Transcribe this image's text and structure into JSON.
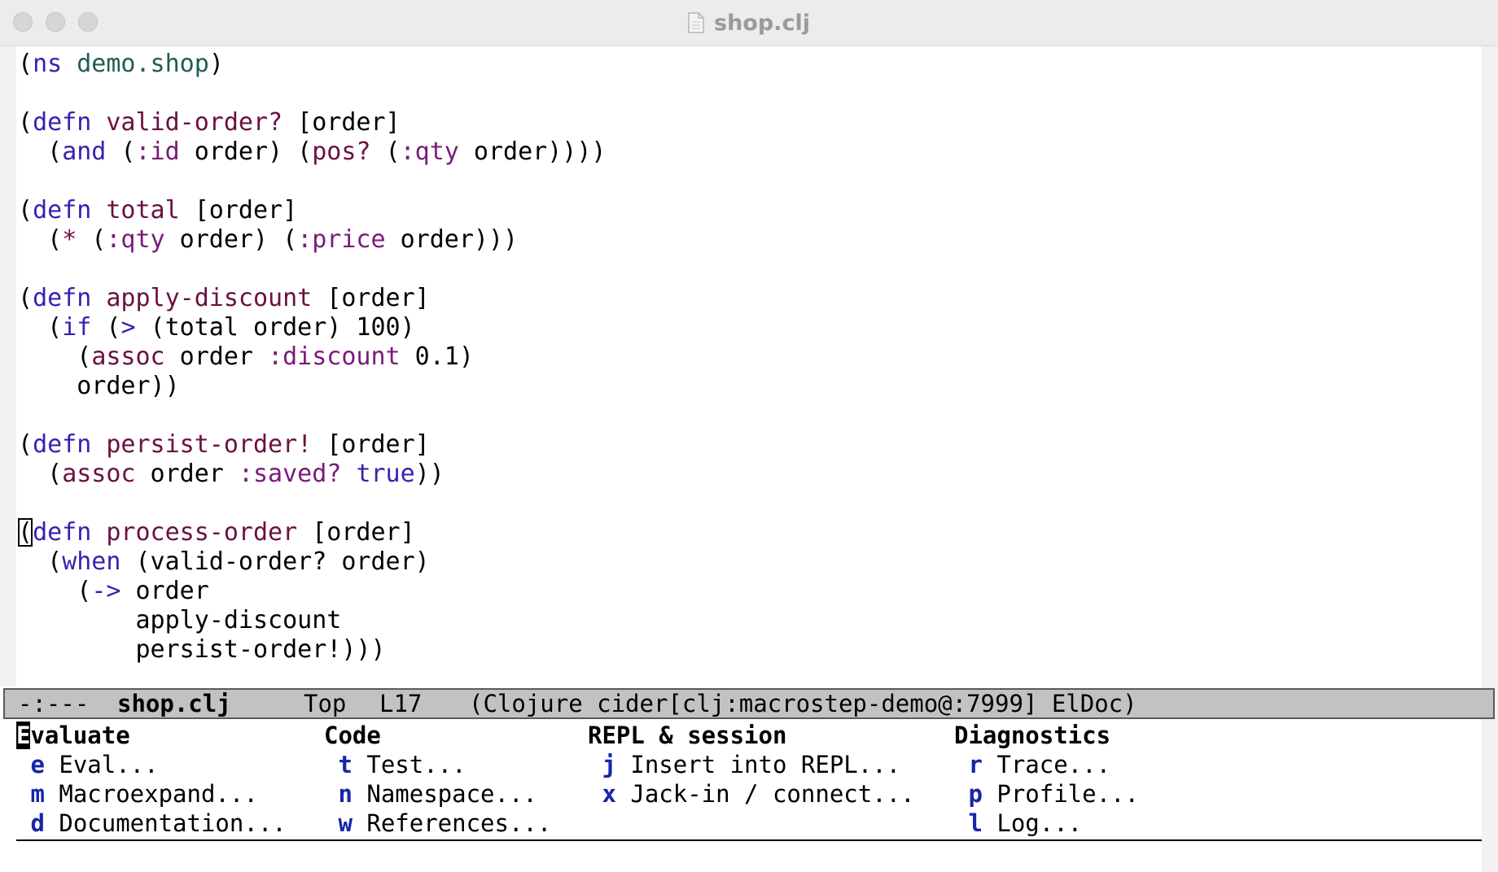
{
  "window": {
    "title": "shop.clj"
  },
  "code_lines": [
    [
      [
        "p",
        "("
      ],
      [
        "kw",
        "ns"
      ],
      [
        "p",
        " "
      ],
      [
        "ns",
        "demo.shop"
      ],
      [
        "p",
        ")"
      ]
    ],
    [],
    [
      [
        "p",
        "("
      ],
      [
        "kw",
        "defn"
      ],
      [
        "p",
        " "
      ],
      [
        "fn",
        "valid-order?"
      ],
      [
        "p",
        " [order]"
      ]
    ],
    [
      [
        "p",
        "  ("
      ],
      [
        "kw",
        "and"
      ],
      [
        "p",
        " ("
      ],
      [
        "key",
        ":id"
      ],
      [
        "p",
        " order) ("
      ],
      [
        "fn",
        "pos?"
      ],
      [
        "p",
        " ("
      ],
      [
        "key",
        ":qty"
      ],
      [
        "p",
        " order))))"
      ]
    ],
    [],
    [
      [
        "p",
        "("
      ],
      [
        "kw",
        "defn"
      ],
      [
        "p",
        " "
      ],
      [
        "fn",
        "total"
      ],
      [
        "p",
        " [order]"
      ]
    ],
    [
      [
        "p",
        "  ("
      ],
      [
        "fn",
        "*"
      ],
      [
        "p",
        " ("
      ],
      [
        "key",
        ":qty"
      ],
      [
        "p",
        " order) ("
      ],
      [
        "key",
        ":price"
      ],
      [
        "p",
        " order)))"
      ]
    ],
    [],
    [
      [
        "p",
        "("
      ],
      [
        "kw",
        "defn"
      ],
      [
        "p",
        " "
      ],
      [
        "fn",
        "apply-discount"
      ],
      [
        "p",
        " [order]"
      ]
    ],
    [
      [
        "p",
        "  ("
      ],
      [
        "kw",
        "if"
      ],
      [
        "p",
        " ("
      ],
      [
        "kw",
        ">"
      ],
      [
        "p",
        " (total order) 100)"
      ]
    ],
    [
      [
        "p",
        "    ("
      ],
      [
        "fn",
        "assoc"
      ],
      [
        "p",
        " order "
      ],
      [
        "key",
        ":discount"
      ],
      [
        "p",
        " 0.1)"
      ]
    ],
    [
      [
        "p",
        "    order))"
      ]
    ],
    [],
    [
      [
        "p",
        "("
      ],
      [
        "kw",
        "defn"
      ],
      [
        "p",
        " "
      ],
      [
        "fn",
        "persist-order!"
      ],
      [
        "p",
        " [order]"
      ]
    ],
    [
      [
        "p",
        "  ("
      ],
      [
        "fn",
        "assoc"
      ],
      [
        "p",
        " order "
      ],
      [
        "key",
        ":saved?"
      ],
      [
        "p",
        " "
      ],
      [
        "const",
        "true"
      ],
      [
        "p",
        "))"
      ]
    ],
    [],
    [
      [
        "cur",
        "("
      ],
      [
        "kw",
        "defn"
      ],
      [
        "p",
        " "
      ],
      [
        "fn",
        "process-order"
      ],
      [
        "p",
        " [order]"
      ]
    ],
    [
      [
        "p",
        "  ("
      ],
      [
        "kw",
        "when"
      ],
      [
        "p",
        " (valid-order? order)"
      ]
    ],
    [
      [
        "p",
        "    ("
      ],
      [
        "kw",
        "->"
      ],
      [
        "p",
        " order"
      ]
    ],
    [
      [
        "p",
        "        apply-discount"
      ]
    ],
    [
      [
        "p",
        "        persist-order!)))"
      ]
    ]
  ],
  "modeline": {
    "status": "-:---",
    "buffer": "shop.clj",
    "position": "Top",
    "line": "L17",
    "modes": "(Clojure cider[clj:macrostep-demo@:7999] ElDoc)"
  },
  "menu": {
    "columns": [
      {
        "heading": "Evaluate",
        "items": [
          {
            "key": "e",
            "label": "Eval..."
          },
          {
            "key": "m",
            "label": "Macroexpand..."
          },
          {
            "key": "d",
            "label": "Documentation..."
          }
        ]
      },
      {
        "heading": "Code",
        "items": [
          {
            "key": "t",
            "label": "Test..."
          },
          {
            "key": "n",
            "label": "Namespace..."
          },
          {
            "key": "w",
            "label": "References..."
          }
        ]
      },
      {
        "heading": "REPL & session",
        "items": [
          {
            "key": "j",
            "label": "Insert into REPL..."
          },
          {
            "key": "x",
            "label": "Jack-in / connect..."
          }
        ]
      },
      {
        "heading": "Diagnostics",
        "items": [
          {
            "key": "r",
            "label": "Trace..."
          },
          {
            "key": "p",
            "label": "Profile..."
          },
          {
            "key": "l",
            "label": "Log..."
          }
        ]
      }
    ]
  }
}
